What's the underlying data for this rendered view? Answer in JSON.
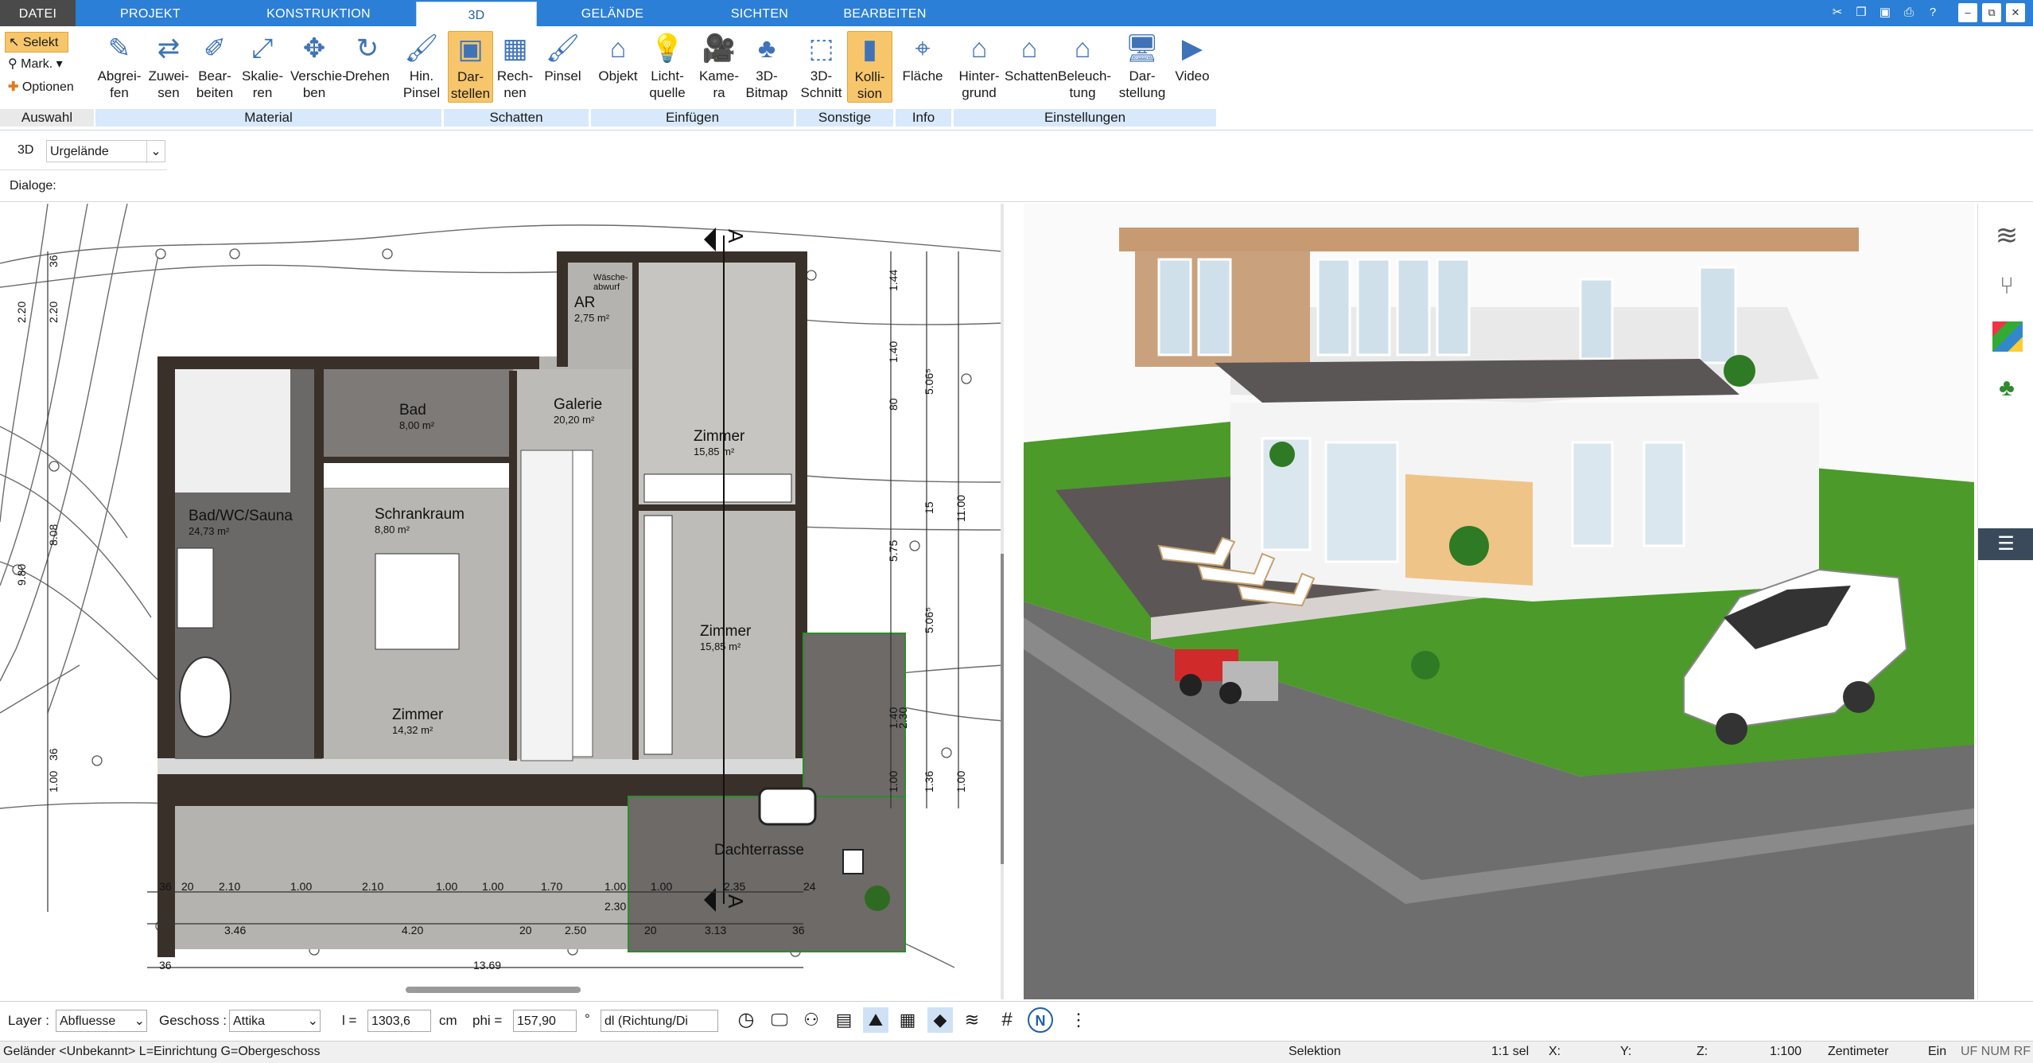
{
  "tabs": [
    "DATEI",
    "PROJEKT",
    "KONSTRUKTION",
    "3D",
    "GELÄNDE",
    "SICHTEN",
    "BEARBEITEN"
  ],
  "active_tab": "3D",
  "auswahl": {
    "selekt": "Selekt",
    "mark": "Mark.",
    "optionen": "Optionen",
    "group": "Auswahl"
  },
  "ribbon": {
    "material": {
      "group": "Material",
      "items": [
        "Abgrei-\nfen",
        "Zuwei-\nsen",
        "Bear-\nbeiten",
        "Skalie-\nren",
        "Verschie-\nben",
        "Drehen",
        "Hin.\nPinsel"
      ]
    },
    "schatten": {
      "group": "Schatten",
      "items": [
        "Dar-\nstellen",
        "Rech-\nnen",
        "Pinsel"
      ]
    },
    "einfuegen": {
      "group": "Einfügen",
      "items": [
        "Objekt",
        "Licht-\nquelle",
        "Kame-\nra",
        "3D-\nBitmap"
      ]
    },
    "sonstige": {
      "group": "Sonstige",
      "items": [
        "3D-\nSchnitt",
        "Kolli-\nsion"
      ]
    },
    "info": {
      "group": "Info",
      "items": [
        "Fläche"
      ]
    },
    "einstellungen": {
      "group": "Einstellungen",
      "items": [
        "Hinter-\ngrund",
        "Schatten",
        "Beleuch-\ntung",
        "Dar-\nstellung",
        "Video"
      ]
    }
  },
  "row3d": {
    "label": "3D",
    "value": "Urgelände"
  },
  "dialoge": "Dialoge:",
  "plan": {
    "rooms": [
      {
        "name": "AR",
        "area": "2,75 m²"
      },
      {
        "name": "Wäsche-\nabwurf",
        "area": ""
      },
      {
        "name": "Bad",
        "area": "8,00 m²"
      },
      {
        "name": "Galerie",
        "area": "20,20 m²"
      },
      {
        "name": "Zimmer",
        "area": "15,85 m²"
      },
      {
        "name": "Bad/WC/Sauna",
        "area": "24,73 m²"
      },
      {
        "name": "Schrankraum",
        "area": "8,80 m²"
      },
      {
        "name": "Zimmer",
        "area": "15,85 m²"
      },
      {
        "name": "Zimmer",
        "area": "14,32 m²"
      },
      {
        "name": "Dachterrasse",
        "area": ""
      }
    ],
    "section_marks": [
      "A",
      "A"
    ],
    "dims_left": [
      "36",
      "2.20",
      "2.20",
      "8.08",
      "9.80",
      "36",
      "1.00"
    ],
    "dims_right": [
      "1.44",
      "1.40",
      "80",
      "5.06⁵",
      "15",
      "11.00",
      "5.75",
      "5.06⁵",
      "1.40",
      "2.30",
      "1.00",
      "1.36",
      "1.00"
    ],
    "dims_bottom_row1": [
      "36",
      "20",
      "2.10",
      "1.00",
      "2.10",
      "1.00",
      "1.00",
      "1.70",
      "1.00",
      "1.00",
      "2.35",
      "24"
    ],
    "dims_bottom_row2": [
      "3.46",
      "4.20",
      "20",
      "2.50",
      "2.30",
      "20",
      "3.13",
      "36"
    ],
    "dims_bottom_row3": [
      "36",
      "13.69"
    ]
  },
  "bottom": {
    "layer_label": "Layer :",
    "layer_value": "Abfluesse",
    "geschoss_label": "Geschoss :",
    "geschoss_value": "Attika",
    "l_label": "l =",
    "l_value": "1303,6",
    "l_unit": "cm",
    "phi_label": "phi =",
    "phi_value": "157,90",
    "phi_unit": "°",
    "dl_value": "dl (Richtung/Di"
  },
  "status": {
    "left": "Geländer <Unbekannt> L=Einrichtung G=Obergeschoss",
    "selektion": "Selektion",
    "sel": "1:1 sel",
    "x": "X:",
    "y": "Y:",
    "z": "Z:",
    "scale": "1:100",
    "unit": "Zentimeter",
    "ein": "Ein",
    "flags": "UF NUM RF"
  },
  "colors": {
    "accent": "#2b7fd6",
    "highlight": "#f7c66b",
    "group_bg": "#d7e9fb",
    "grass": "#4c9a2a",
    "deck": "#5c5756"
  }
}
